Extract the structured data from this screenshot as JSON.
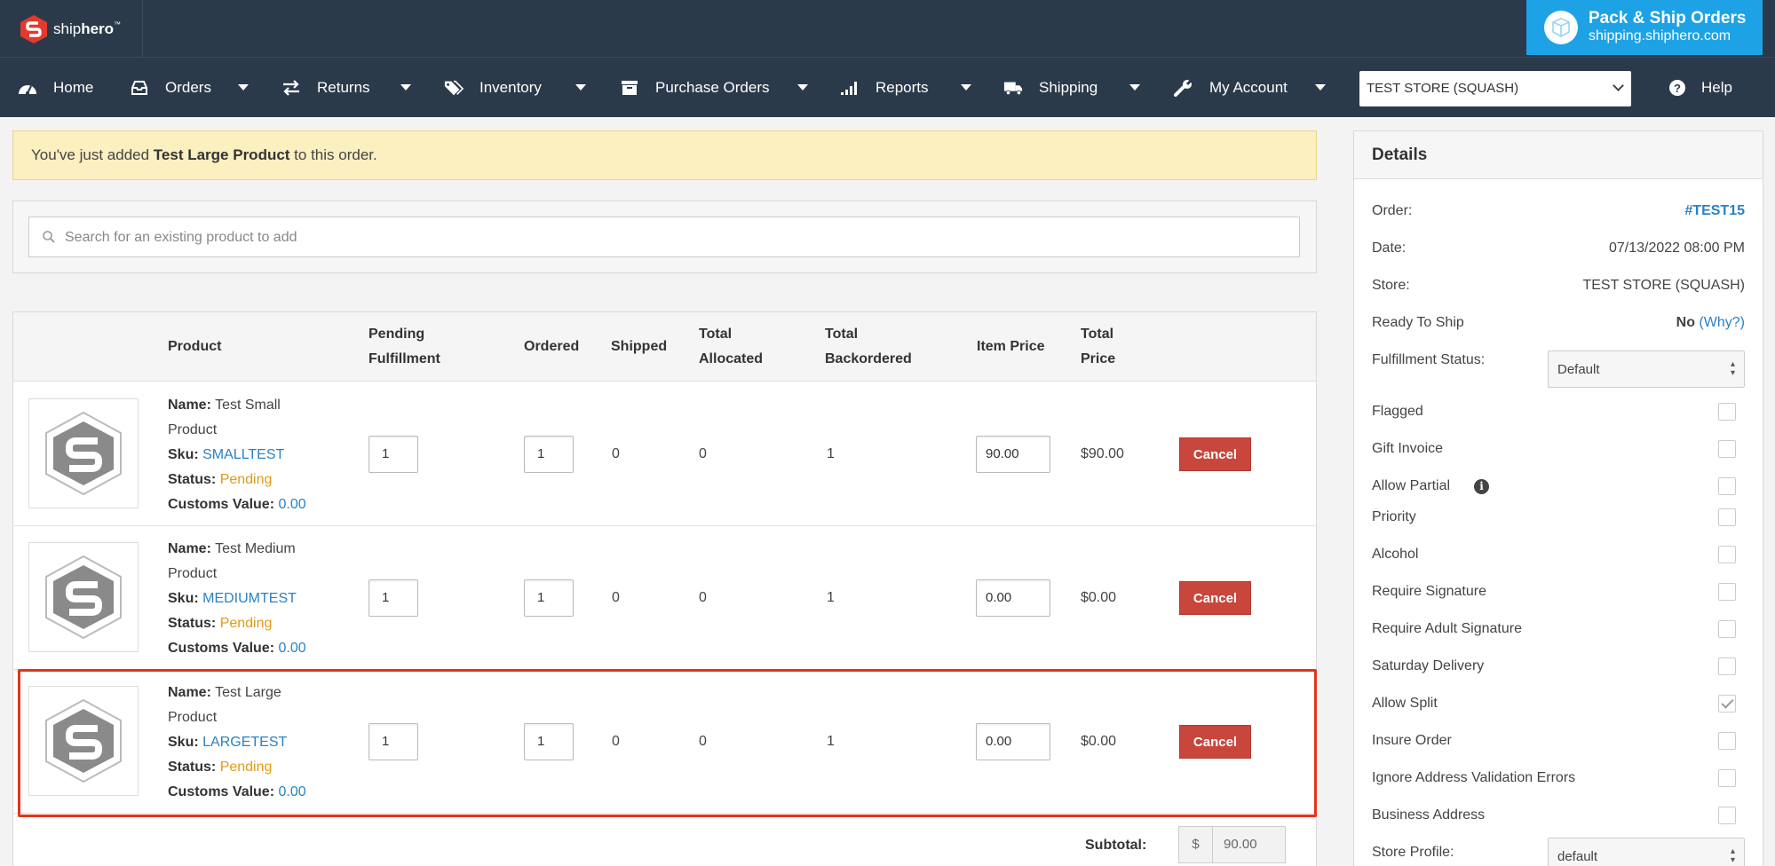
{
  "brand": {
    "name_part1": "ship",
    "name_part2": "hero",
    "tm": "™"
  },
  "promo": {
    "line1": "Pack & Ship Orders",
    "line2": "shipping.shiphero.com"
  },
  "nav": {
    "items": [
      {
        "label": "Home",
        "icon": "dashboard-icon"
      },
      {
        "label": "Orders",
        "icon": "inbox-icon"
      },
      {
        "label": "Returns",
        "icon": "swap-arrows-icon"
      },
      {
        "label": "Inventory",
        "icon": "tags-icon"
      },
      {
        "label": "Purchase Orders",
        "icon": "archive-box-icon"
      },
      {
        "label": "Reports",
        "icon": "bar-signal-icon"
      },
      {
        "label": "Shipping",
        "icon": "truck-icon"
      },
      {
        "label": "My Account",
        "icon": "wrench-icon"
      }
    ],
    "store_select": "TEST STORE (SQUASH)",
    "help": "Help"
  },
  "alert": {
    "prefix": "You've just added ",
    "product": "Test Large Product",
    "suffix": " to this order."
  },
  "search": {
    "placeholder": "Search for an existing product to add"
  },
  "table": {
    "headers": {
      "product": "Product",
      "pending_1": "Pending",
      "pending_2": "Fulfillment",
      "ordered": "Ordered",
      "shipped": "Shipped",
      "allocated_1": "Total",
      "allocated_2": "Allocated",
      "backordered_1": "Total",
      "backordered_2": "Backordered",
      "item_price": "Item Price",
      "total_price_1": "Total",
      "total_price_2": "Price"
    },
    "labels": {
      "name": "Name:",
      "sku": "Sku:",
      "status": "Status:",
      "customs": "Customs Value:"
    },
    "rows": [
      {
        "name_1": "Test Small",
        "name_2": "Product",
        "sku": "SMALLTEST",
        "status": "Pending",
        "customs": "0.00",
        "pending": "1",
        "ordered": "1",
        "shipped": "0",
        "allocated": "0",
        "backordered": "1",
        "item_price": "90.00",
        "total_price": "$90.00",
        "cancel": "Cancel"
      },
      {
        "name_1": "Test Medium",
        "name_2": "Product",
        "sku": "MEDIUMTEST",
        "status": "Pending",
        "customs": "0.00",
        "pending": "1",
        "ordered": "1",
        "shipped": "0",
        "allocated": "0",
        "backordered": "1",
        "item_price": "0.00",
        "total_price": "$0.00",
        "cancel": "Cancel"
      },
      {
        "name_1": "Test Large",
        "name_2": "Product",
        "sku": "LARGETEST",
        "status": "Pending",
        "customs": "0.00",
        "pending": "1",
        "ordered": "1",
        "shipped": "0",
        "allocated": "0",
        "backordered": "1",
        "item_price": "0.00",
        "total_price": "$0.00",
        "cancel": "Cancel"
      }
    ],
    "subtotal_label": "Subtotal:",
    "subtotal_currency": "$",
    "subtotal_value": "90.00"
  },
  "details": {
    "title": "Details",
    "order_label": "Order:",
    "order_value": "#TEST15",
    "date_label": "Date:",
    "date_value": "07/13/2022 08:00 PM",
    "store_label": "Store:",
    "store_value": "TEST STORE (SQUASH)",
    "ready_label": "Ready To Ship",
    "ready_value": "No",
    "ready_why": "(Why?)",
    "fulfillment_label": "Fulfillment Status:",
    "fulfillment_value": "Default",
    "flags": [
      {
        "label": "Flagged",
        "checked": false
      },
      {
        "label": "Gift Invoice",
        "checked": false
      },
      {
        "label": "Allow Partial",
        "checked": false
      },
      {
        "label": "Priority",
        "checked": false
      },
      {
        "label": "Alcohol",
        "checked": false
      },
      {
        "label": "Require Signature",
        "checked": false
      },
      {
        "label": "Require Adult Signature",
        "checked": false
      },
      {
        "label": "Saturday Delivery",
        "checked": false
      },
      {
        "label": "Allow Split",
        "checked": true
      },
      {
        "label": "Insure Order",
        "checked": false
      },
      {
        "label": "Ignore Address Validation Errors",
        "checked": false
      },
      {
        "label": "Business Address",
        "checked": false
      }
    ],
    "store_profile_label": "Store Profile:",
    "store_profile_value": "default"
  }
}
